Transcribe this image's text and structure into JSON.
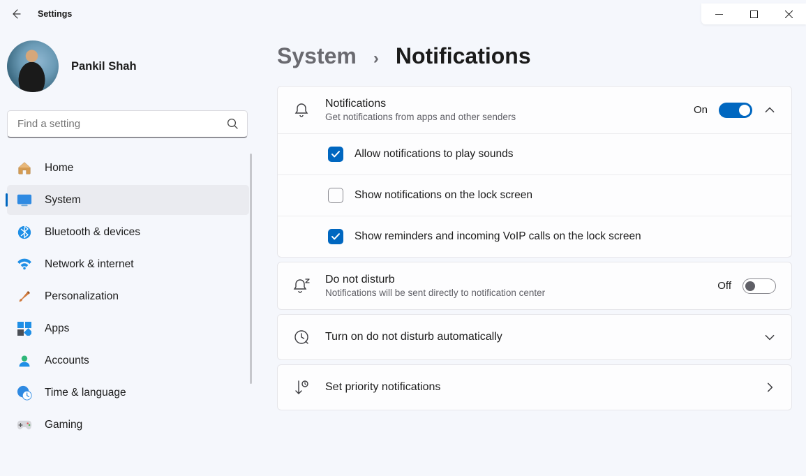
{
  "app_title": "Settings",
  "user": {
    "name": "Pankil Shah"
  },
  "search": {
    "placeholder": "Find a setting"
  },
  "nav": [
    {
      "key": "home",
      "label": "Home"
    },
    {
      "key": "system",
      "label": "System"
    },
    {
      "key": "bt",
      "label": "Bluetooth & devices"
    },
    {
      "key": "net",
      "label": "Network & internet"
    },
    {
      "key": "pers",
      "label": "Personalization"
    },
    {
      "key": "apps",
      "label": "Apps"
    },
    {
      "key": "acct",
      "label": "Accounts"
    },
    {
      "key": "time",
      "label": "Time & language"
    },
    {
      "key": "gaming",
      "label": "Gaming"
    }
  ],
  "nav_active": "system",
  "breadcrumb": {
    "parent": "System",
    "page": "Notifications"
  },
  "panels": {
    "notifications": {
      "title": "Notifications",
      "subtitle": "Get notifications from apps and other senders",
      "state_label": "On",
      "state": true,
      "options": [
        {
          "label": "Allow notifications to play sounds",
          "checked": true
        },
        {
          "label": "Show notifications on the lock screen",
          "checked": false
        },
        {
          "label": "Show reminders and incoming VoIP calls on the lock screen",
          "checked": true
        }
      ]
    },
    "dnd": {
      "title": "Do not disturb",
      "subtitle": "Notifications will be sent directly to notification center",
      "state_label": "Off",
      "state": false
    },
    "dnd_auto": {
      "title": "Turn on do not disturb automatically"
    },
    "priority": {
      "title": "Set priority notifications"
    }
  },
  "colors": {
    "accent": "#0067c0"
  }
}
